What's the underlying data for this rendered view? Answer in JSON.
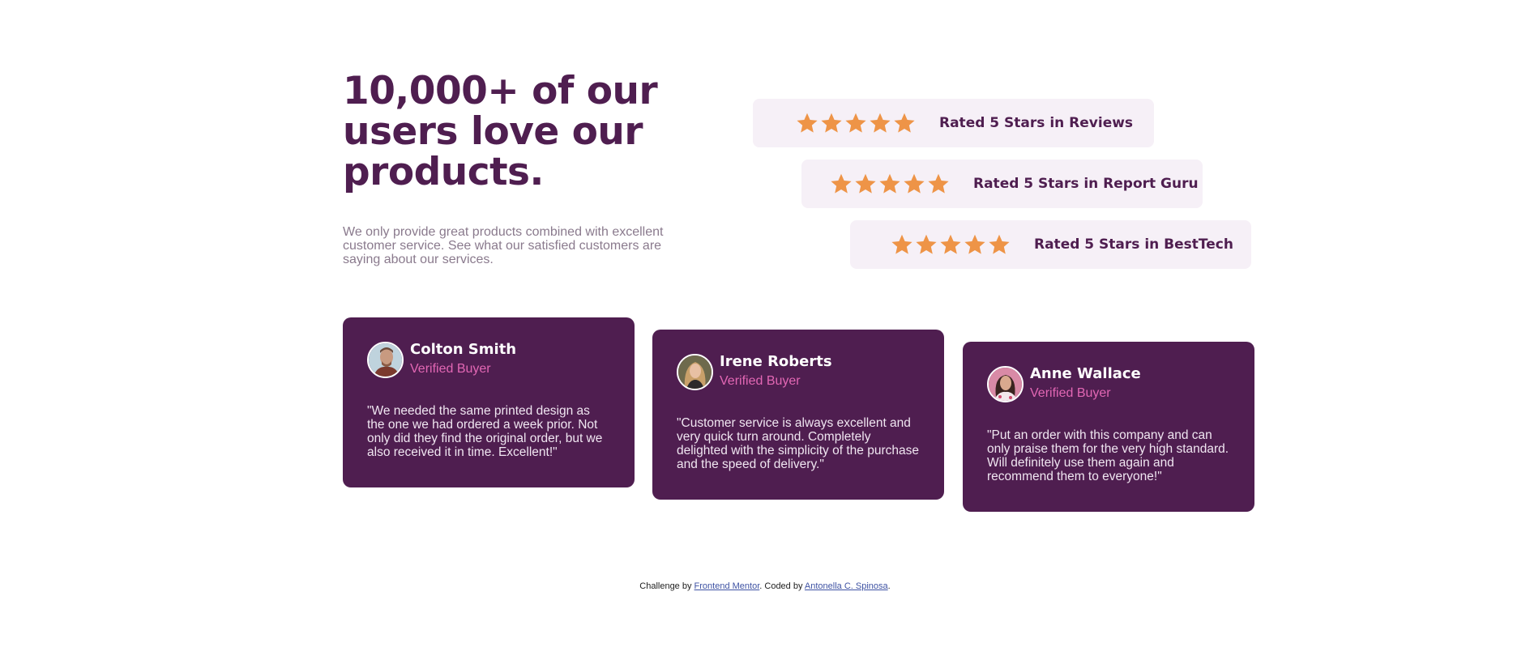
{
  "hero": {
    "title": "10,000+ of our users love our products.",
    "description": "We only provide great products combined with excellent customer service. See what our satisfied customers are saying about our services."
  },
  "ratings": [
    {
      "stars": 5,
      "label": "Rated 5 Stars in Reviews"
    },
    {
      "stars": 5,
      "label": "Rated 5 Stars in Report Guru"
    },
    {
      "stars": 5,
      "label": "Rated 5 Stars in BestTech"
    }
  ],
  "testimonials": [
    {
      "name": "Colton Smith",
      "role": "Verified Buyer",
      "quote": "\"We needed the same printed design as the one we had ordered a week prior. Not only did they find the original order, but we also received it in time. Excellent!\""
    },
    {
      "name": "Irene Roberts",
      "role": "Verified Buyer",
      "quote": "\"Customer service is always excellent and very quick turn around. Completely delighted with the simplicity of the purchase and the speed of delivery.\""
    },
    {
      "name": "Anne Wallace",
      "role": "Verified Buyer",
      "quote": "\"Put an order with this company and can only praise them for the very high standard. Will definitely use them again and recommend them to everyone!\""
    }
  ],
  "footer": {
    "prefix": "Challenge by",
    "challenge_link": "Frontend Mentor",
    "middle": ". Coded by",
    "author_link": "Antonella C. Spinosa",
    "suffix": "."
  },
  "colors": {
    "primary": "#4f1e50",
    "accent": "#e267b4",
    "star": "#ee9447",
    "rating_bg": "#f6f0f7"
  },
  "icons": {
    "star": "star-icon",
    "avatar": "avatar"
  }
}
